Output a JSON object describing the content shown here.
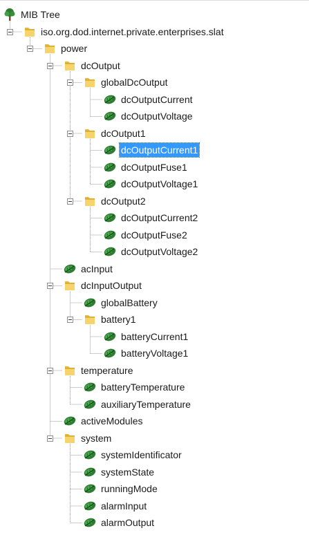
{
  "tree": {
    "root": {
      "label": "MIB Tree",
      "icon": "tree-icon",
      "children": [
        {
          "label": "iso.org.dod.internet.private.enterprises.slat",
          "type": "folder",
          "expanded": true,
          "children": [
            {
              "label": "power",
              "type": "folder",
              "expanded": true,
              "children": [
                {
                  "label": "dcOutput",
                  "type": "folder",
                  "expanded": true,
                  "children": [
                    {
                      "label": "globalDcOutput",
                      "type": "folder",
                      "expanded": true,
                      "children": [
                        {
                          "label": "dcOutputCurrent",
                          "type": "leaf"
                        },
                        {
                          "label": "dcOutputVoltage",
                          "type": "leaf"
                        }
                      ]
                    },
                    {
                      "label": "dcOutput1",
                      "type": "folder",
                      "expanded": true,
                      "children": [
                        {
                          "label": "dcOutputCurrent1",
                          "type": "leaf",
                          "selected": true
                        },
                        {
                          "label": "dcOutputFuse1",
                          "type": "leaf"
                        },
                        {
                          "label": "dcOutputVoltage1",
                          "type": "leaf"
                        }
                      ]
                    },
                    {
                      "label": "dcOutput2",
                      "type": "folder",
                      "expanded": true,
                      "children": [
                        {
                          "label": "dcOutputCurrent2",
                          "type": "leaf"
                        },
                        {
                          "label": "dcOutputFuse2",
                          "type": "leaf"
                        },
                        {
                          "label": "dcOutputVoltage2",
                          "type": "leaf"
                        }
                      ]
                    }
                  ]
                },
                {
                  "label": "acInput",
                  "type": "leaf"
                },
                {
                  "label": "dcInputOutput",
                  "type": "folder",
                  "expanded": true,
                  "children": [
                    {
                      "label": "globalBattery",
                      "type": "leaf"
                    },
                    {
                      "label": "battery1",
                      "type": "folder",
                      "expanded": true,
                      "children": [
                        {
                          "label": "batteryCurrent1",
                          "type": "leaf"
                        },
                        {
                          "label": "batteryVoltage1",
                          "type": "leaf"
                        }
                      ]
                    }
                  ]
                },
                {
                  "label": "temperature",
                  "type": "folder",
                  "expanded": true,
                  "children": [
                    {
                      "label": "batteryTemperature",
                      "type": "leaf"
                    },
                    {
                      "label": "auxiliaryTemperature",
                      "type": "leaf"
                    }
                  ]
                },
                {
                  "label": "activeModules",
                  "type": "leaf"
                },
                {
                  "label": "system",
                  "type": "folder",
                  "expanded": true,
                  "children": [
                    {
                      "label": "systemIdentificator",
                      "type": "leaf"
                    },
                    {
                      "label": "systemState",
                      "type": "leaf"
                    },
                    {
                      "label": "runningMode",
                      "type": "leaf"
                    },
                    {
                      "label": "alarmInput",
                      "type": "leaf"
                    },
                    {
                      "label": "alarmOutput",
                      "type": "leaf"
                    }
                  ]
                }
              ]
            }
          ]
        }
      ]
    },
    "icons": {
      "folder": "folder-icon",
      "leaf": "leaf-icon",
      "expander": "collapse-toggle-icon"
    },
    "colors": {
      "selection": "#3399ff",
      "connector": "#9a9a9a",
      "folder": "#f2c94c",
      "leaf": "#2e7d32"
    }
  }
}
